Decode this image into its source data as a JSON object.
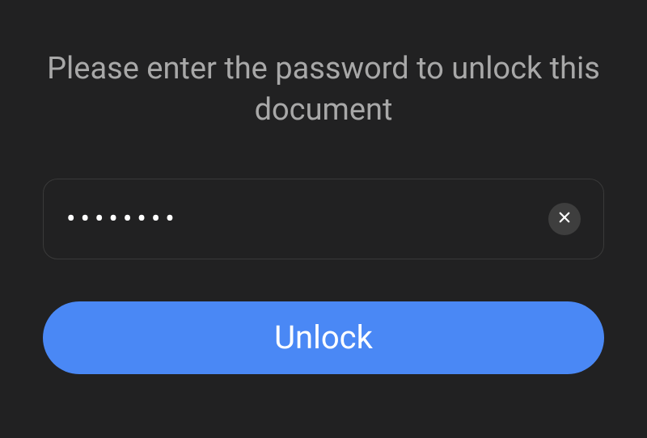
{
  "prompt": {
    "text": "Please enter the password to unlock this document"
  },
  "password": {
    "masked_value": "••••••••"
  },
  "buttons": {
    "unlock_label": "Unlock"
  },
  "colors": {
    "background": "#212122",
    "text_muted": "#a8a8a8",
    "accent": "#4a88f5"
  }
}
